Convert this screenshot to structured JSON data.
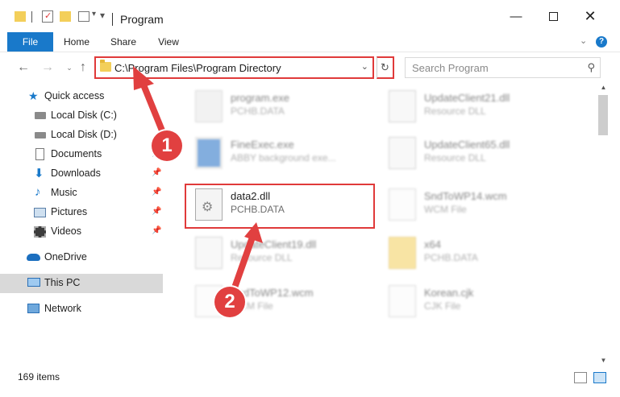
{
  "window": {
    "title": "Program"
  },
  "ribbon": {
    "tabs": [
      "File",
      "Home",
      "Share",
      "View"
    ]
  },
  "address": {
    "path": "C:\\Program Files\\Program Directory"
  },
  "search": {
    "placeholder": "Search Program"
  },
  "sidebar": {
    "items": [
      {
        "label": "Quick access",
        "icon": "star-icon"
      },
      {
        "label": "Local Disk (C:)",
        "icon": "drive-icon"
      },
      {
        "label": "Local Disk (D:)",
        "icon": "drive-icon"
      },
      {
        "label": "Documents",
        "icon": "documents-icon"
      },
      {
        "label": "Downloads",
        "icon": "download-icon"
      },
      {
        "label": "Music",
        "icon": "music-icon"
      },
      {
        "label": "Pictures",
        "icon": "pictures-icon"
      },
      {
        "label": "Videos",
        "icon": "videos-icon"
      },
      {
        "label": "OneDrive",
        "icon": "cloud-icon"
      },
      {
        "label": "This PC",
        "icon": "computer-icon"
      },
      {
        "label": "Network",
        "icon": "network-icon"
      }
    ]
  },
  "files": [
    {
      "name": "program.exe",
      "sub": "PCHB.DATA"
    },
    {
      "name": "UpdateClient21.dll",
      "sub": "Resource DLL"
    },
    {
      "name": "FineExec.exe",
      "sub": "ABBY background exe..."
    },
    {
      "name": "UpdateClient65.dll",
      "sub": "Resource DLL"
    },
    {
      "name": "data2.dll",
      "sub": "PCHB.DATA"
    },
    {
      "name": "SndToWP14.wcm",
      "sub": "WCM File"
    },
    {
      "name": "UpdateClient19.dll",
      "sub": "Resource DLL"
    },
    {
      "name": "x64",
      "sub": "PCHB.DATA"
    },
    {
      "name": "SndToWP12.wcm",
      "sub": "WCM File"
    },
    {
      "name": "Korean.cjk",
      "sub": "CJK File"
    }
  ],
  "status": {
    "item_count": "169 items"
  },
  "markers": [
    "1",
    "2"
  ],
  "colors": {
    "accent": "#1979ca",
    "highlight": "#e03a3a",
    "selected": "#d9d9d9"
  }
}
